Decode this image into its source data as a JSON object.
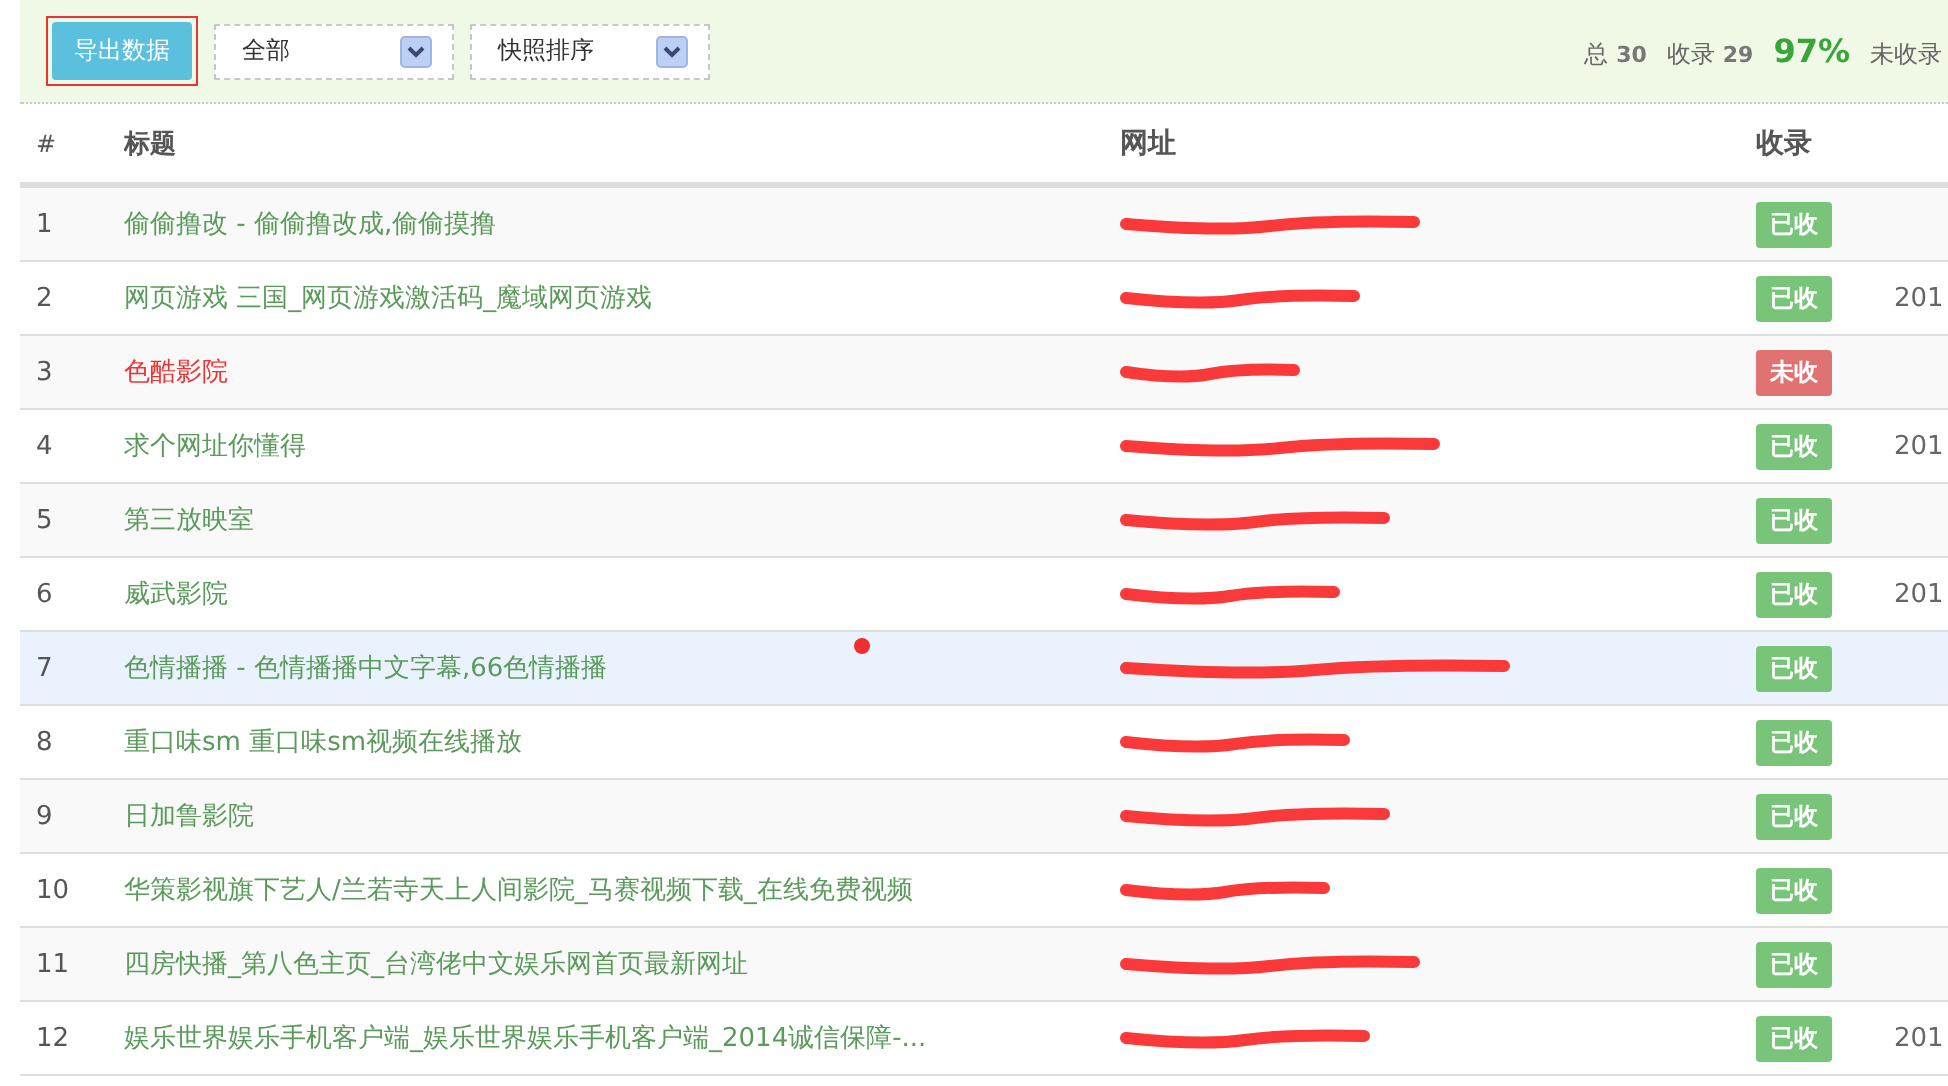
{
  "toolbar": {
    "export_button": "导出数据",
    "filters": [
      {
        "value": "全部"
      },
      {
        "value": "快照排序"
      }
    ],
    "stats": [
      {
        "label": "总",
        "value": "30"
      },
      {
        "label": "收录",
        "value": "29"
      }
    ],
    "percent": "97%",
    "unindexed_label": "未收录"
  },
  "table": {
    "columns": [
      "#",
      "标题",
      "网址",
      "收录"
    ],
    "rows": [
      {
        "index": "1",
        "title": "偷偷撸改 - 偷偷撸改成,偷偷摸撸",
        "indexed": true,
        "badge": "已收",
        "highlighted": false
      },
      {
        "index": "2",
        "title": "网页游戏 三国_网页游戏激活码_魔域网页游戏",
        "indexed": true,
        "badge": "已收",
        "highlighted": false,
        "date": "201"
      },
      {
        "index": "3",
        "title": "色酷影院",
        "indexed": false,
        "badge": "未收",
        "highlighted": false
      },
      {
        "index": "4",
        "title": "求个网址你懂得",
        "indexed": true,
        "badge": "已收",
        "highlighted": false,
        "date": "201"
      },
      {
        "index": "5",
        "title": "第三放映室",
        "indexed": true,
        "badge": "已收",
        "highlighted": false
      },
      {
        "index": "6",
        "title": "威武影院",
        "indexed": true,
        "badge": "已收",
        "highlighted": false,
        "date": "201"
      },
      {
        "index": "7",
        "title": "色情播播 - 色情播播中文字幕,66色情播播",
        "indexed": true,
        "badge": "已收",
        "highlighted": true
      },
      {
        "index": "8",
        "title": "重口味sm 重口味sm视频在线播放",
        "indexed": true,
        "badge": "已收",
        "highlighted": false
      },
      {
        "index": "9",
        "title": "日加鲁影院",
        "indexed": true,
        "badge": "已收",
        "highlighted": false
      },
      {
        "index": "10",
        "title": "华策影视旗下艺人/兰若寺天上人间影院_马赛视频下载_在线免费视频",
        "indexed": true,
        "badge": "已收",
        "highlighted": false
      },
      {
        "index": "11",
        "title": "四房快播_第八色主页_台湾佬中文娱乐网首页最新网址",
        "indexed": true,
        "badge": "已收",
        "highlighted": false
      },
      {
        "index": "12",
        "title": "娱乐世界娱乐手机客户端_娱乐世界娱乐手机客户端_2014诚信保障-...",
        "indexed": true,
        "badge": "已收",
        "highlighted": false,
        "date": "201"
      }
    ]
  }
}
